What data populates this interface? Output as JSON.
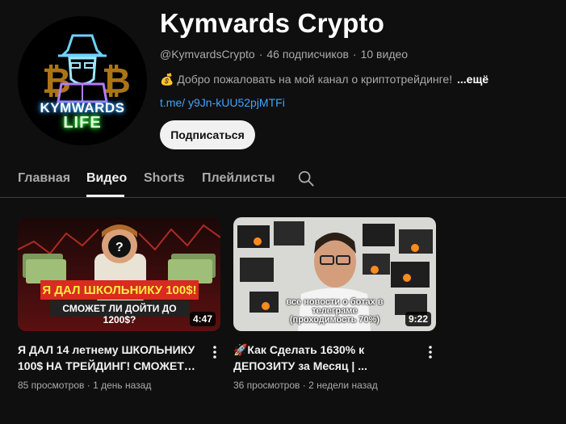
{
  "channel": {
    "title": "Kymvards Crypto",
    "handle": "@KymvardsCrypto",
    "subscribers": "46 подписчиков",
    "videos_count": "10 видео",
    "separator": "·",
    "description_emoji": "💰",
    "description": "Добро пожаловать на мой канал о криптотрейдинге!",
    "more_label": "...ещё",
    "link": "t.me/ y9Jn-kUU52pjMTFi",
    "subscribe_label": "Подписаться",
    "avatar_text_top": "KYMWARDS",
    "avatar_text_bottom": "LIFE"
  },
  "tabs": [
    {
      "label": "Главная"
    },
    {
      "label": "Видео"
    },
    {
      "label": "Shorts"
    },
    {
      "label": "Плейлисты"
    }
  ],
  "videos": [
    {
      "title": "Я ДАЛ 14 летнему ШКОЛЬНИКУ 100$ НА ТРЕЙДИНГ! СМОЖЕТ л...",
      "views": "85 просмотров",
      "age": "1 день назад",
      "duration": "4:47",
      "thumb_line1": "Я ДАЛ ШКОЛЬНИКУ 100$!",
      "thumb_line2": "СМОЖЕТ ЛИ ДОЙТИ ДО 1200$?"
    },
    {
      "title": "🚀Как Сделать 1630% к ДЕПОЗИТУ за Месяц | ...",
      "views": "36 просмотров",
      "age": "2 недели назад",
      "duration": "9:22",
      "thumb_line1": "все новости о ботах в",
      "thumb_line2": "телеграме",
      "thumb_line3": "(проходимость 70%)"
    }
  ],
  "colors": {
    "background": "#0f0f0f",
    "link": "#3ea6ff",
    "secondary_text": "#aaaaaa",
    "thumb1_banner": "#d92b1f"
  }
}
